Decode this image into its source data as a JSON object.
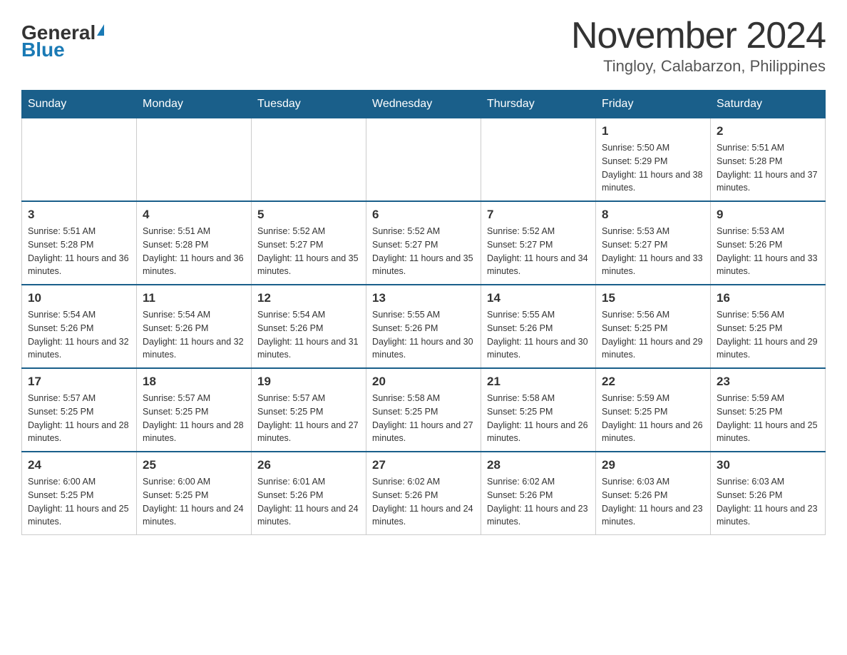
{
  "header": {
    "logo_general": "General",
    "logo_blue": "Blue",
    "title": "November 2024",
    "subtitle": "Tingloy, Calabarzon, Philippines"
  },
  "calendar": {
    "days_of_week": [
      "Sunday",
      "Monday",
      "Tuesday",
      "Wednesday",
      "Thursday",
      "Friday",
      "Saturday"
    ],
    "weeks": [
      [
        {
          "day": "",
          "info": ""
        },
        {
          "day": "",
          "info": ""
        },
        {
          "day": "",
          "info": ""
        },
        {
          "day": "",
          "info": ""
        },
        {
          "day": "",
          "info": ""
        },
        {
          "day": "1",
          "info": "Sunrise: 5:50 AM\nSunset: 5:29 PM\nDaylight: 11 hours and 38 minutes."
        },
        {
          "day": "2",
          "info": "Sunrise: 5:51 AM\nSunset: 5:28 PM\nDaylight: 11 hours and 37 minutes."
        }
      ],
      [
        {
          "day": "3",
          "info": "Sunrise: 5:51 AM\nSunset: 5:28 PM\nDaylight: 11 hours and 36 minutes."
        },
        {
          "day": "4",
          "info": "Sunrise: 5:51 AM\nSunset: 5:28 PM\nDaylight: 11 hours and 36 minutes."
        },
        {
          "day": "5",
          "info": "Sunrise: 5:52 AM\nSunset: 5:27 PM\nDaylight: 11 hours and 35 minutes."
        },
        {
          "day": "6",
          "info": "Sunrise: 5:52 AM\nSunset: 5:27 PM\nDaylight: 11 hours and 35 minutes."
        },
        {
          "day": "7",
          "info": "Sunrise: 5:52 AM\nSunset: 5:27 PM\nDaylight: 11 hours and 34 minutes."
        },
        {
          "day": "8",
          "info": "Sunrise: 5:53 AM\nSunset: 5:27 PM\nDaylight: 11 hours and 33 minutes."
        },
        {
          "day": "9",
          "info": "Sunrise: 5:53 AM\nSunset: 5:26 PM\nDaylight: 11 hours and 33 minutes."
        }
      ],
      [
        {
          "day": "10",
          "info": "Sunrise: 5:54 AM\nSunset: 5:26 PM\nDaylight: 11 hours and 32 minutes."
        },
        {
          "day": "11",
          "info": "Sunrise: 5:54 AM\nSunset: 5:26 PM\nDaylight: 11 hours and 32 minutes."
        },
        {
          "day": "12",
          "info": "Sunrise: 5:54 AM\nSunset: 5:26 PM\nDaylight: 11 hours and 31 minutes."
        },
        {
          "day": "13",
          "info": "Sunrise: 5:55 AM\nSunset: 5:26 PM\nDaylight: 11 hours and 30 minutes."
        },
        {
          "day": "14",
          "info": "Sunrise: 5:55 AM\nSunset: 5:26 PM\nDaylight: 11 hours and 30 minutes."
        },
        {
          "day": "15",
          "info": "Sunrise: 5:56 AM\nSunset: 5:25 PM\nDaylight: 11 hours and 29 minutes."
        },
        {
          "day": "16",
          "info": "Sunrise: 5:56 AM\nSunset: 5:25 PM\nDaylight: 11 hours and 29 minutes."
        }
      ],
      [
        {
          "day": "17",
          "info": "Sunrise: 5:57 AM\nSunset: 5:25 PM\nDaylight: 11 hours and 28 minutes."
        },
        {
          "day": "18",
          "info": "Sunrise: 5:57 AM\nSunset: 5:25 PM\nDaylight: 11 hours and 28 minutes."
        },
        {
          "day": "19",
          "info": "Sunrise: 5:57 AM\nSunset: 5:25 PM\nDaylight: 11 hours and 27 minutes."
        },
        {
          "day": "20",
          "info": "Sunrise: 5:58 AM\nSunset: 5:25 PM\nDaylight: 11 hours and 27 minutes."
        },
        {
          "day": "21",
          "info": "Sunrise: 5:58 AM\nSunset: 5:25 PM\nDaylight: 11 hours and 26 minutes."
        },
        {
          "day": "22",
          "info": "Sunrise: 5:59 AM\nSunset: 5:25 PM\nDaylight: 11 hours and 26 minutes."
        },
        {
          "day": "23",
          "info": "Sunrise: 5:59 AM\nSunset: 5:25 PM\nDaylight: 11 hours and 25 minutes."
        }
      ],
      [
        {
          "day": "24",
          "info": "Sunrise: 6:00 AM\nSunset: 5:25 PM\nDaylight: 11 hours and 25 minutes."
        },
        {
          "day": "25",
          "info": "Sunrise: 6:00 AM\nSunset: 5:25 PM\nDaylight: 11 hours and 24 minutes."
        },
        {
          "day": "26",
          "info": "Sunrise: 6:01 AM\nSunset: 5:26 PM\nDaylight: 11 hours and 24 minutes."
        },
        {
          "day": "27",
          "info": "Sunrise: 6:02 AM\nSunset: 5:26 PM\nDaylight: 11 hours and 24 minutes."
        },
        {
          "day": "28",
          "info": "Sunrise: 6:02 AM\nSunset: 5:26 PM\nDaylight: 11 hours and 23 minutes."
        },
        {
          "day": "29",
          "info": "Sunrise: 6:03 AM\nSunset: 5:26 PM\nDaylight: 11 hours and 23 minutes."
        },
        {
          "day": "30",
          "info": "Sunrise: 6:03 AM\nSunset: 5:26 PM\nDaylight: 11 hours and 23 minutes."
        }
      ]
    ]
  }
}
